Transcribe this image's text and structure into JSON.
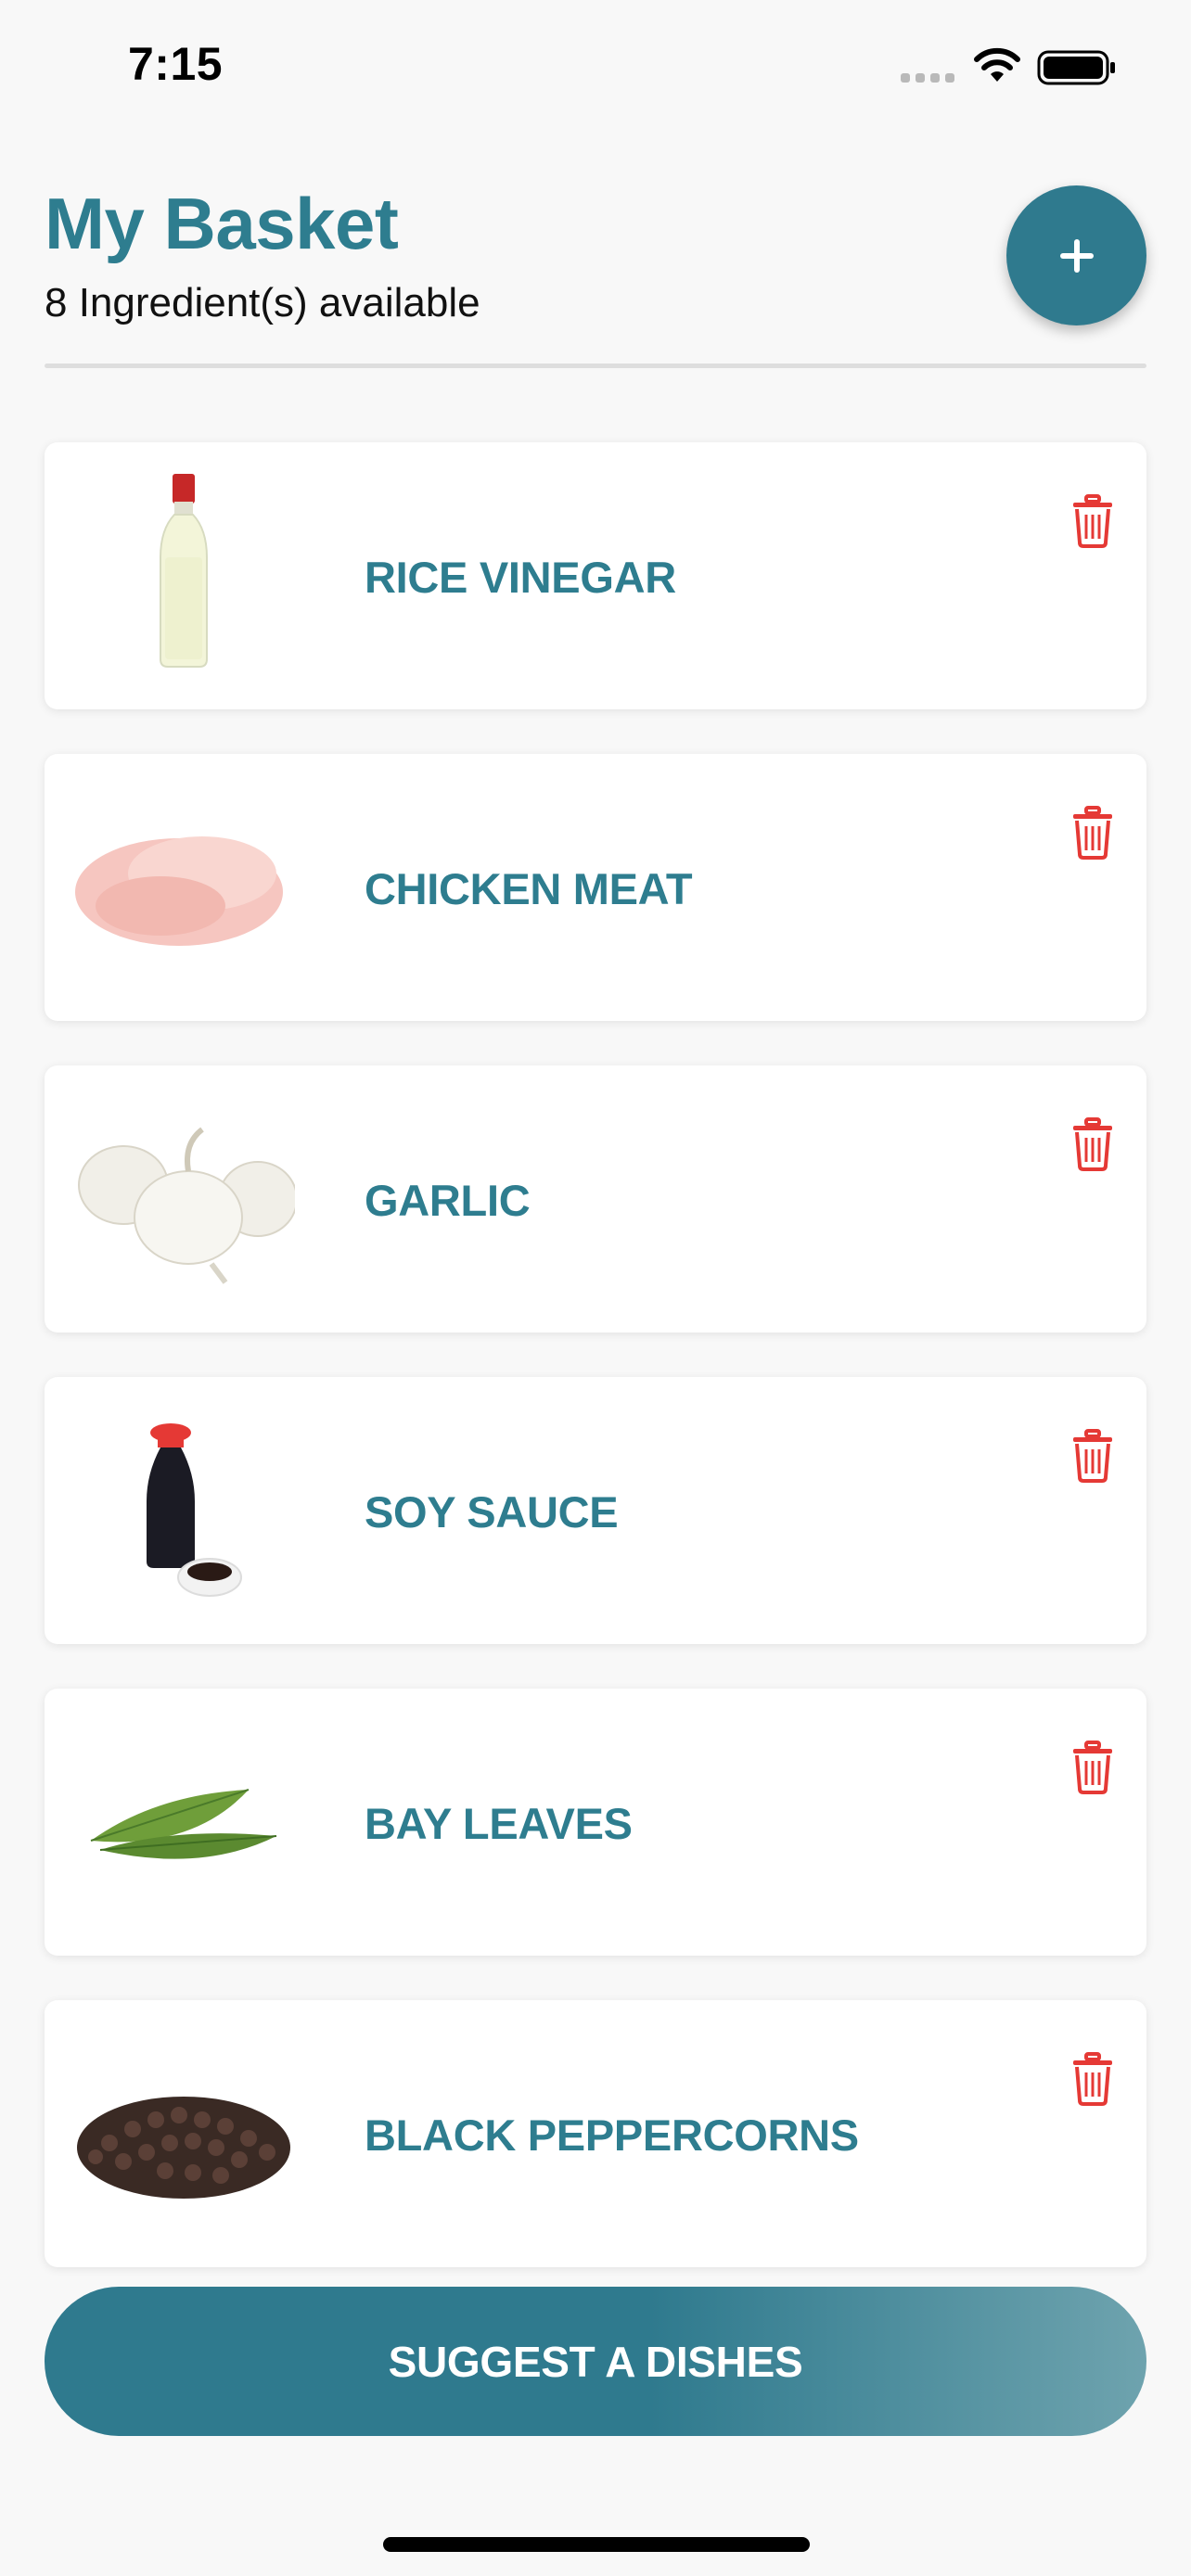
{
  "status_bar": {
    "time": "7:15"
  },
  "header": {
    "title": "My Basket",
    "subtitle": "8 Ingredient(s) available"
  },
  "ingredients": [
    {
      "name": "RICE VINEGAR",
      "icon": "rice-vinegar-bottle"
    },
    {
      "name": "CHICKEN MEAT",
      "icon": "chicken-breast"
    },
    {
      "name": "GARLIC",
      "icon": "garlic-bulbs"
    },
    {
      "name": "SOY SAUCE",
      "icon": "soy-sauce-bottle"
    },
    {
      "name": "BAY LEAVES",
      "icon": "bay-leaves"
    },
    {
      "name": "BLACK PEPPERCORNS",
      "icon": "black-peppercorns"
    }
  ],
  "suggest_button": {
    "label": "SUGGEST A DISHES"
  },
  "colors": {
    "primary": "#2f7a8e",
    "delete": "#e53935",
    "background": "#f8f8f8"
  }
}
